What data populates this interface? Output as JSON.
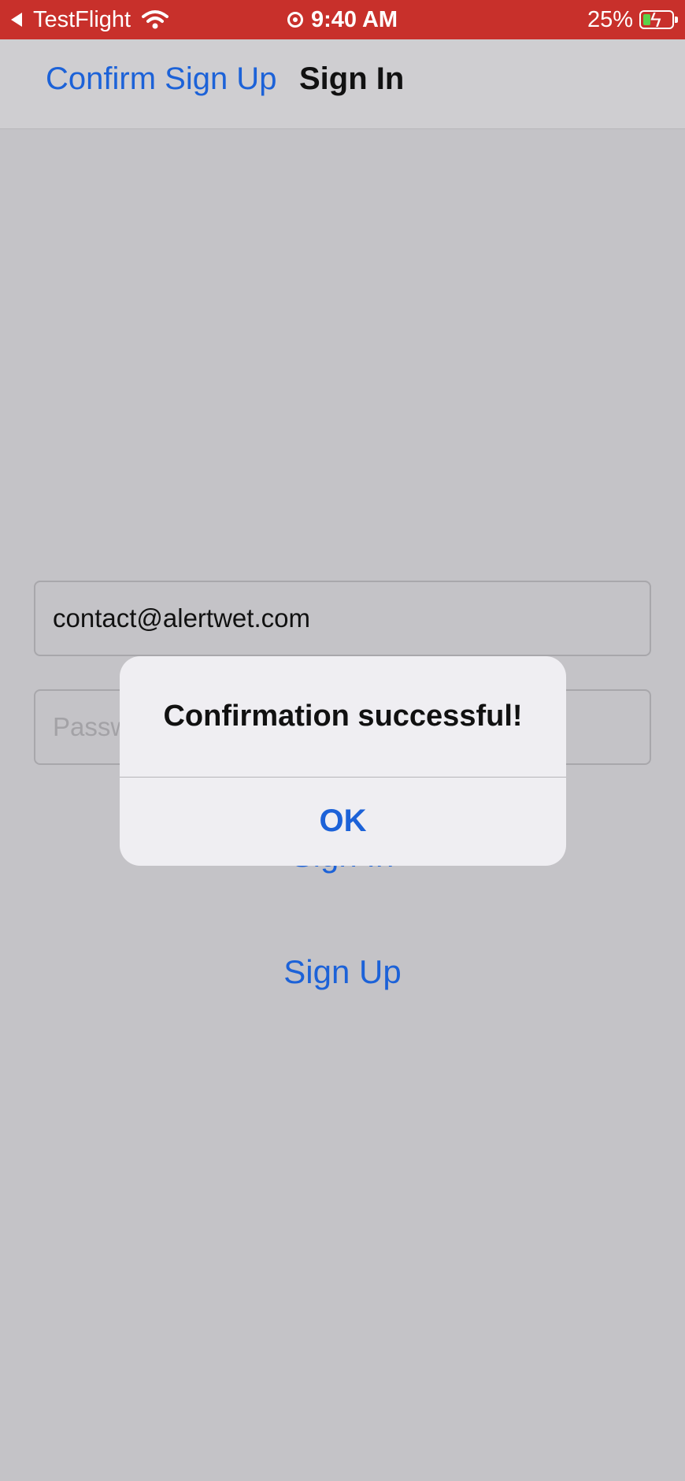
{
  "status_bar": {
    "back_app": "TestFlight",
    "time": "9:40 AM",
    "battery_pct": "25%",
    "battery_level": 0.25,
    "colors": {
      "background": "#c8302b",
      "battery_fill": "#5ad24b"
    },
    "icons": [
      "back-arrow-icon",
      "wifi-icon",
      "location-icon",
      "battery-charging-icon"
    ]
  },
  "nav": {
    "back_label": "Confirm Sign Up",
    "title": "Sign In"
  },
  "form": {
    "email_value": "contact@alertwet.com",
    "password_placeholder": "Password"
  },
  "buttons": {
    "sign_in": "Sign In",
    "sign_up": "Sign Up"
  },
  "alert": {
    "title": "Confirmation successful!",
    "ok_label": "OK"
  },
  "colors": {
    "accent": "#1c62d8",
    "dimmed_background": "#c4c3c7",
    "alert_background": "#efeef2"
  }
}
